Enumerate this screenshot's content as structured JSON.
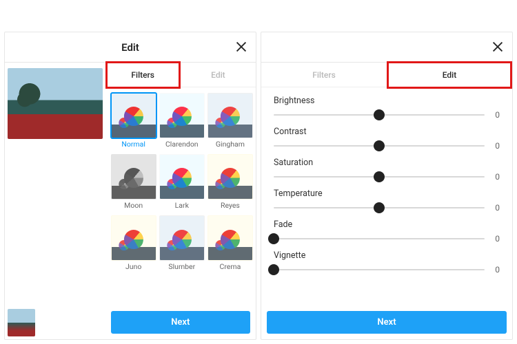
{
  "left_panel": {
    "title": "Edit",
    "tabs": {
      "filters": "Filters",
      "edit": "Edit",
      "active": "filters"
    },
    "filters": [
      {
        "name": "Normal",
        "selected": true,
        "variant": ""
      },
      {
        "name": "Clarendon",
        "selected": false,
        "variant": "cool"
      },
      {
        "name": "Gingham",
        "selected": false,
        "variant": "fade"
      },
      {
        "name": "Moon",
        "selected": false,
        "variant": "mono"
      },
      {
        "name": "Lark",
        "selected": false,
        "variant": "cool"
      },
      {
        "name": "Reyes",
        "selected": false,
        "variant": "warm"
      },
      {
        "name": "Juno",
        "selected": false,
        "variant": "warm"
      },
      {
        "name": "Slumber",
        "selected": false,
        "variant": "fade"
      },
      {
        "name": "Crema",
        "selected": false,
        "variant": "warm"
      }
    ],
    "next_label": "Next"
  },
  "right_panel": {
    "tabs": {
      "filters": "Filters",
      "edit": "Edit",
      "active": "edit"
    },
    "sliders": [
      {
        "key": "brightness",
        "label": "Brightness",
        "value": 0,
        "min": -100,
        "max": 100
      },
      {
        "key": "contrast",
        "label": "Contrast",
        "value": 0,
        "min": -100,
        "max": 100
      },
      {
        "key": "saturation",
        "label": "Saturation",
        "value": 0,
        "min": -100,
        "max": 100
      },
      {
        "key": "temperature",
        "label": "Temperature",
        "value": 0,
        "min": -100,
        "max": 100
      },
      {
        "key": "fade",
        "label": "Fade",
        "value": 0,
        "min": 0,
        "max": 100
      },
      {
        "key": "vignette",
        "label": "Vignette",
        "value": 0,
        "min": 0,
        "max": 100
      }
    ],
    "next_label": "Next"
  }
}
